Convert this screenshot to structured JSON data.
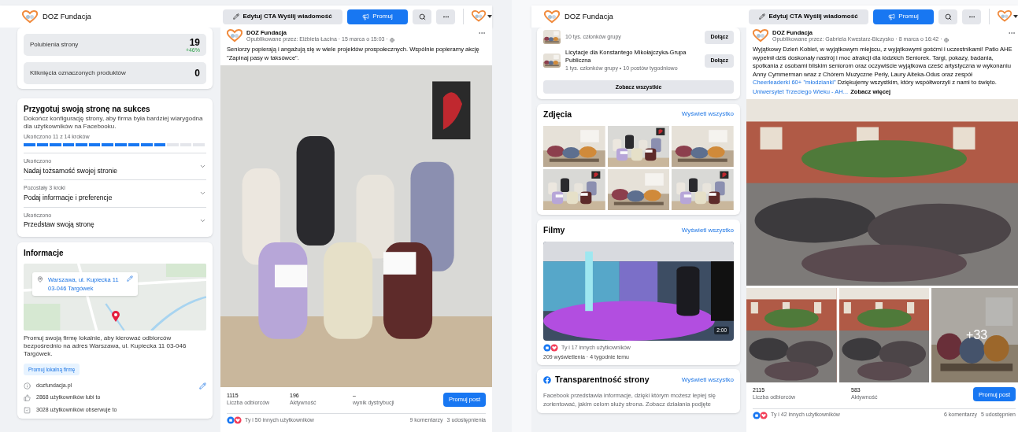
{
  "panels": [
    {
      "header": {
        "page_name": "DOZ Fundacja",
        "buttons": [
          {
            "kind": "edit",
            "label": "Edytuj CTA Wyślij wiadomość"
          },
          {
            "kind": "promote",
            "label": "Promuj"
          },
          {
            "kind": "search"
          },
          {
            "kind": "more"
          }
        ]
      },
      "sidebar": [
        {
          "kind": "stats",
          "rows": [
            {
              "label": "Polubienia strony",
              "value": "19",
              "change": "+46%"
            },
            {
              "label": "Kliknięcia oznaczonych produktów",
              "value": "0"
            }
          ]
        },
        {
          "kind": "setup",
          "title": "Przygotuj swoją stronę na sukces",
          "description": "Dokończ konfigurację strony, aby firma była bardziej wiarygodna dla użytkowników na Facebooku.",
          "progress_label": "Ukończono 11 z 14 kroków",
          "level": 0.786,
          "steps": [
            {
              "status": "Ukończono",
              "title": "Nadaj tożsamość swojej stronie",
              "expanded": false
            },
            {
              "status": "Pozostały 3 kroki",
              "title": "Podaj informacje i preferencje",
              "expanded": false
            },
            {
              "status": "Ukończono",
              "title": "Przedstaw swoją stronę",
              "expanded": false
            }
          ]
        },
        {
          "kind": "info",
          "title": "Informacje",
          "address_lines": [
            "Warszawa, ul. Kupiecka 11",
            "03-046 Targówek"
          ],
          "promo_text": "Promuj swoją firmę lokalnie, aby kierować odbiorców bezpośrednio na adres Warszawa, ul. Kupiecka 11 03-046 Targówek.",
          "promo_button": "Promuj lokalną firmę",
          "rows": [
            {
              "kind": "website",
              "text": "dozfundacja.pl",
              "editable": true
            },
            {
              "kind": "likes",
              "text": "2868 użytkowników lubi to",
              "editable": false
            },
            {
              "kind": "followers",
              "text": "3028 użytkowników obserwuje to",
              "editable": false
            }
          ]
        }
      ],
      "post": {
        "author": "DOZ Fundacja",
        "meta": "Opublikowane przez: Elżbieta Łacina · 15 marca o 15:03 ·",
        "text": [
          {
            "kind": "plain",
            "text": "Seniorzy popierają i angażują się w wiele projektów prospołecznych. Wspólnie popieramy akcję \"Zapinaj pasy w taksówce\"."
          }
        ],
        "photos": [
          {
            "kind": "picture"
          }
        ],
        "stats": [
          {
            "value": "1115",
            "label": "Liczba odbiorców"
          },
          {
            "value": "196",
            "label": "Aktywność"
          },
          {
            "value": "–",
            "label": "wynik dystrybucji"
          }
        ],
        "promote_button": "Promuj post",
        "reactions": "Ty i 50 innych użytkowników",
        "comments": "9 komentarzy",
        "shares": "3 udostępnienia"
      }
    },
    {
      "header": {
        "page_name": "DOZ Fundacja",
        "buttons": [
          {
            "kind": "edit",
            "label": "Edytuj CTA Wyślij wiadomość"
          },
          {
            "kind": "promote",
            "label": "Promuj"
          },
          {
            "kind": "search"
          },
          {
            "kind": "more"
          }
        ]
      },
      "sidebar": [
        {
          "kind": "groups",
          "items": [
            {
              "members": "10 tys. członków grupy",
              "button": "Dołącz"
            },
            {
              "name": "Licytacje dla Konstantego Mikołajczyka-Grupa Publiczna",
              "members": "1 tys. członków grupy • 10 postów tygodniowo",
              "button": "Dołącz"
            }
          ],
          "see_all": "Zobacz wszystkie"
        },
        {
          "kind": "photos",
          "title": "Zdjęcia",
          "link": "Wyświetl wszystko",
          "photos": [
            {
              "kind": "picture"
            },
            {
              "kind": "picture"
            },
            {
              "kind": "picture"
            },
            {
              "kind": "picture"
            },
            {
              "kind": "picture"
            },
            {
              "kind": "picture"
            }
          ]
        },
        {
          "kind": "videos",
          "title": "Filmy",
          "link": "Wyświetl wszystko",
          "duration": "2:00",
          "reactions": "Ty i 17 innych użytkowników",
          "meta": "209 wyświetlenia · 4 tygodnie temu"
        },
        {
          "kind": "transparency",
          "title": "Transparentność strony",
          "link": "Wyświetl wszystko",
          "text": "Facebook przedstawia informacje, dzięki którym możesz lepiej się zorientować, jakim celom służy strona. Zobacz działania podjęte"
        }
      ],
      "post": {
        "author": "DOZ Fundacja",
        "meta": "Opublikowane przez: Gabriela Kwestarz-Biczysko · 8 marca o 16:42 ·",
        "text": [
          {
            "kind": "plain",
            "text": "Wyjątkowy Dzień Kobiet, w wyjątkowym miejscu, z wyjątkowymi gośćmi i uczestnikami! Patio AHE wypełnił dziś doskonały nastrój i moc atrakcji dla łódzkich Seniorek. Targi, pokazy, badania, spotkania z osobami bliskim seniorom oraz oczywiście wyjątkowa cześć artystyczna w wykonaniu Anny Cymmerman wraz z Chórem Muzyczne Perły, Laury Aiteka-Odus oraz zespół"
          },
          {
            "kind": "link",
            "text": "Cheerleaderki 60+ \"młodzianki\""
          },
          {
            "kind": "plain",
            "text": "Dziękujemy wszystkim, który współtworzyli z nami to święto."
          }
        ],
        "more": [
          {
            "kind": "link",
            "text": "Uniwersytet Trzeciego Wieku - AH..."
          },
          {
            "kind": "plain",
            "text": "Zobacz więcej"
          }
        ],
        "photos": [
          {
            "kind": "picture"
          },
          {
            "kind": "picture"
          },
          {
            "kind": "picture"
          },
          {
            "kind": "picture",
            "overlay": "+33"
          }
        ],
        "stats": [
          {
            "value": "2115",
            "label": "Liczba odbiorców"
          },
          {
            "value": "583",
            "label": "Aktywność"
          }
        ],
        "promote_button": "Promuj post",
        "reactions": "Ty i 42 innych użytkowników",
        "comments": "6 komentarzy",
        "shares": "5 udostępnien"
      }
    }
  ]
}
